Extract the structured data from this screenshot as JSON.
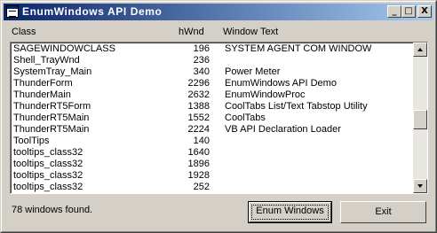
{
  "window": {
    "title": "EnumWindows API Demo",
    "controls": {
      "minimize": "_",
      "maximize": "□",
      "close": "X"
    }
  },
  "columns": {
    "class": "Class",
    "hwnd": "hWnd",
    "text": "Window Text"
  },
  "rows": [
    {
      "class": "SAGEWINDOWCLASS",
      "hwnd": "196",
      "text": "SYSTEM AGENT COM WINDOW"
    },
    {
      "class": "Shell_TrayWnd",
      "hwnd": "236",
      "text": ""
    },
    {
      "class": "SystemTray_Main",
      "hwnd": "340",
      "text": "Power Meter"
    },
    {
      "class": "ThunderForm",
      "hwnd": "2296",
      "text": "EnumWindows API Demo"
    },
    {
      "class": "ThunderMain",
      "hwnd": "2632",
      "text": "EnumWindowProc"
    },
    {
      "class": "ThunderRT5Form",
      "hwnd": "1388",
      "text": "CoolTabs List/Text Tabstop Utility"
    },
    {
      "class": "ThunderRT5Main",
      "hwnd": "1552",
      "text": "CoolTabs"
    },
    {
      "class": "ThunderRT5Main",
      "hwnd": "2224",
      "text": "VB API Declaration Loader"
    },
    {
      "class": "ToolTips",
      "hwnd": "140",
      "text": ""
    },
    {
      "class": "tooltips_class32",
      "hwnd": "1640",
      "text": ""
    },
    {
      "class": "tooltips_class32",
      "hwnd": "1896",
      "text": ""
    },
    {
      "class": "tooltips_class32",
      "hwnd": "1928",
      "text": ""
    },
    {
      "class": "tooltips_class32",
      "hwnd": "252",
      "text": ""
    }
  ],
  "status": "78 windows found.",
  "buttons": {
    "enum": "Enum Windows",
    "exit": "Exit"
  },
  "scrollbar": {
    "position": 0.52
  },
  "colors": {
    "title_start": "#0a246a",
    "title_end": "#a6caf0",
    "face": "#d4d0c8"
  }
}
